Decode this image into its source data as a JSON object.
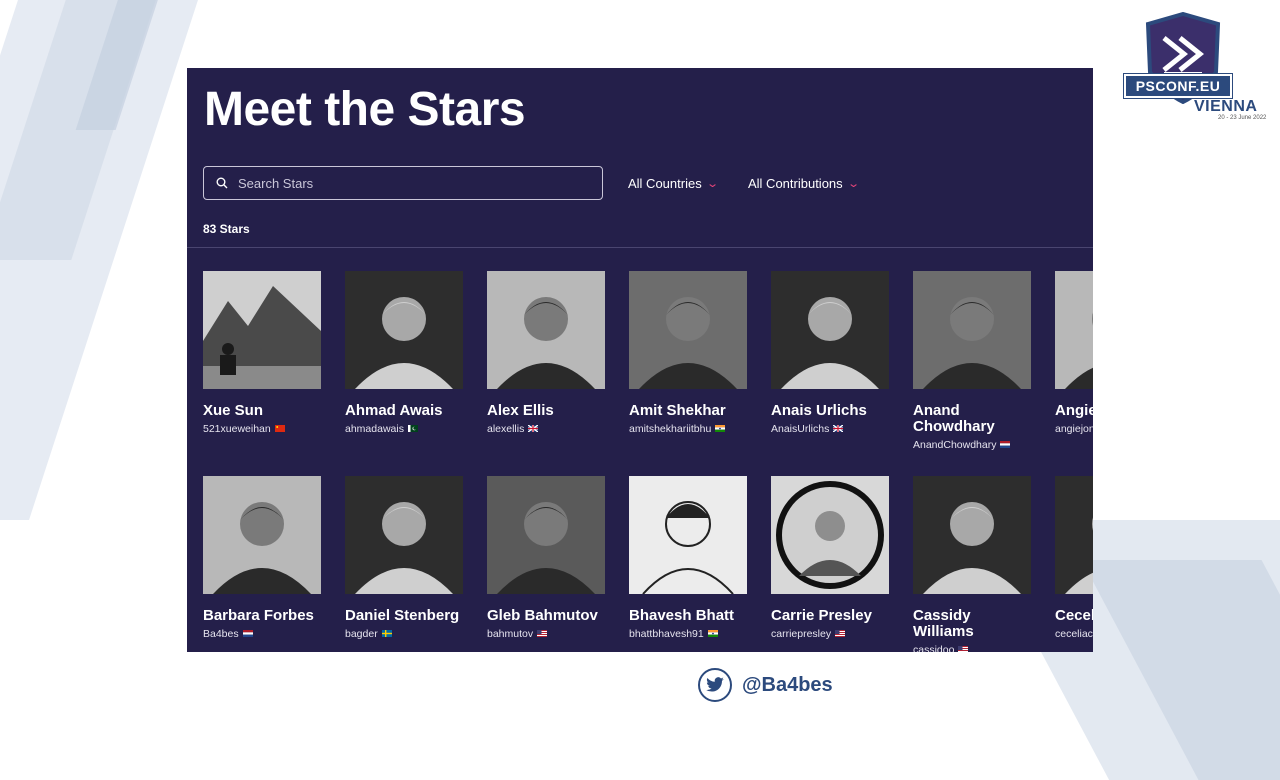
{
  "conference": {
    "logo_text": "PSCONF.EU",
    "city": "VIENNA",
    "dates": "20 - 23 June 2022"
  },
  "page": {
    "title": "Meet the Stars",
    "search_placeholder": "Search Stars",
    "filters": [
      {
        "label": "All Countries"
      },
      {
        "label": "All Contributions"
      }
    ],
    "count_label": "83 Stars"
  },
  "stars": [
    {
      "name": "Xue Sun",
      "handle": "521xueweihan",
      "flag": "cn",
      "photo": "landscape"
    },
    {
      "name": "Ahmad Awais",
      "handle": "ahmadawais",
      "flag": "pk",
      "photo": "portrait-dark"
    },
    {
      "name": "Alex Ellis",
      "handle": "alexellis",
      "flag": "gb",
      "photo": "portrait-light"
    },
    {
      "name": "Amit Shekhar",
      "handle": "amitshekhariitbhu",
      "flag": "in",
      "photo": "portrait-suit"
    },
    {
      "name": "Anais Urlichs",
      "handle": "AnaisUrlichs",
      "flag": "gb",
      "photo": "portrait-dark"
    },
    {
      "name": "Anand Chowdhary",
      "handle": "AnandChowdhary",
      "flag": "nl",
      "photo": "portrait-suit"
    },
    {
      "name": "Angie Jones",
      "handle": "angiejones",
      "flag": "us",
      "photo": "portrait-light"
    },
    {
      "name": "Barbara Forbes",
      "handle": "Ba4bes",
      "flag": "nl",
      "photo": "portrait-light"
    },
    {
      "name": "Daniel Stenberg",
      "handle": "bagder",
      "flag": "se",
      "photo": "portrait-dark"
    },
    {
      "name": "Gleb Bahmutov",
      "handle": "bahmutov",
      "flag": "us",
      "photo": "portrait-office"
    },
    {
      "name": "Bhavesh Bhatt",
      "handle": "bhattbhavesh91",
      "flag": "in",
      "photo": "portrait-sketch"
    },
    {
      "name": "Carrie Presley",
      "handle": "carriepresley",
      "flag": "us",
      "photo": "portrait-circle"
    },
    {
      "name": "Cassidy Williams",
      "handle": "cassidoo",
      "flag": "us",
      "photo": "portrait-dark"
    },
    {
      "name": "Cecelia Martinez",
      "handle": "ceceliacreates",
      "flag": "us",
      "photo": "portrait-dark"
    }
  ],
  "twitter": {
    "handle": "@Ba4bes"
  },
  "colors": {
    "panel_bg": "#241f4a",
    "accent": "#e8457a",
    "brand_blue": "#2c4a7d"
  }
}
